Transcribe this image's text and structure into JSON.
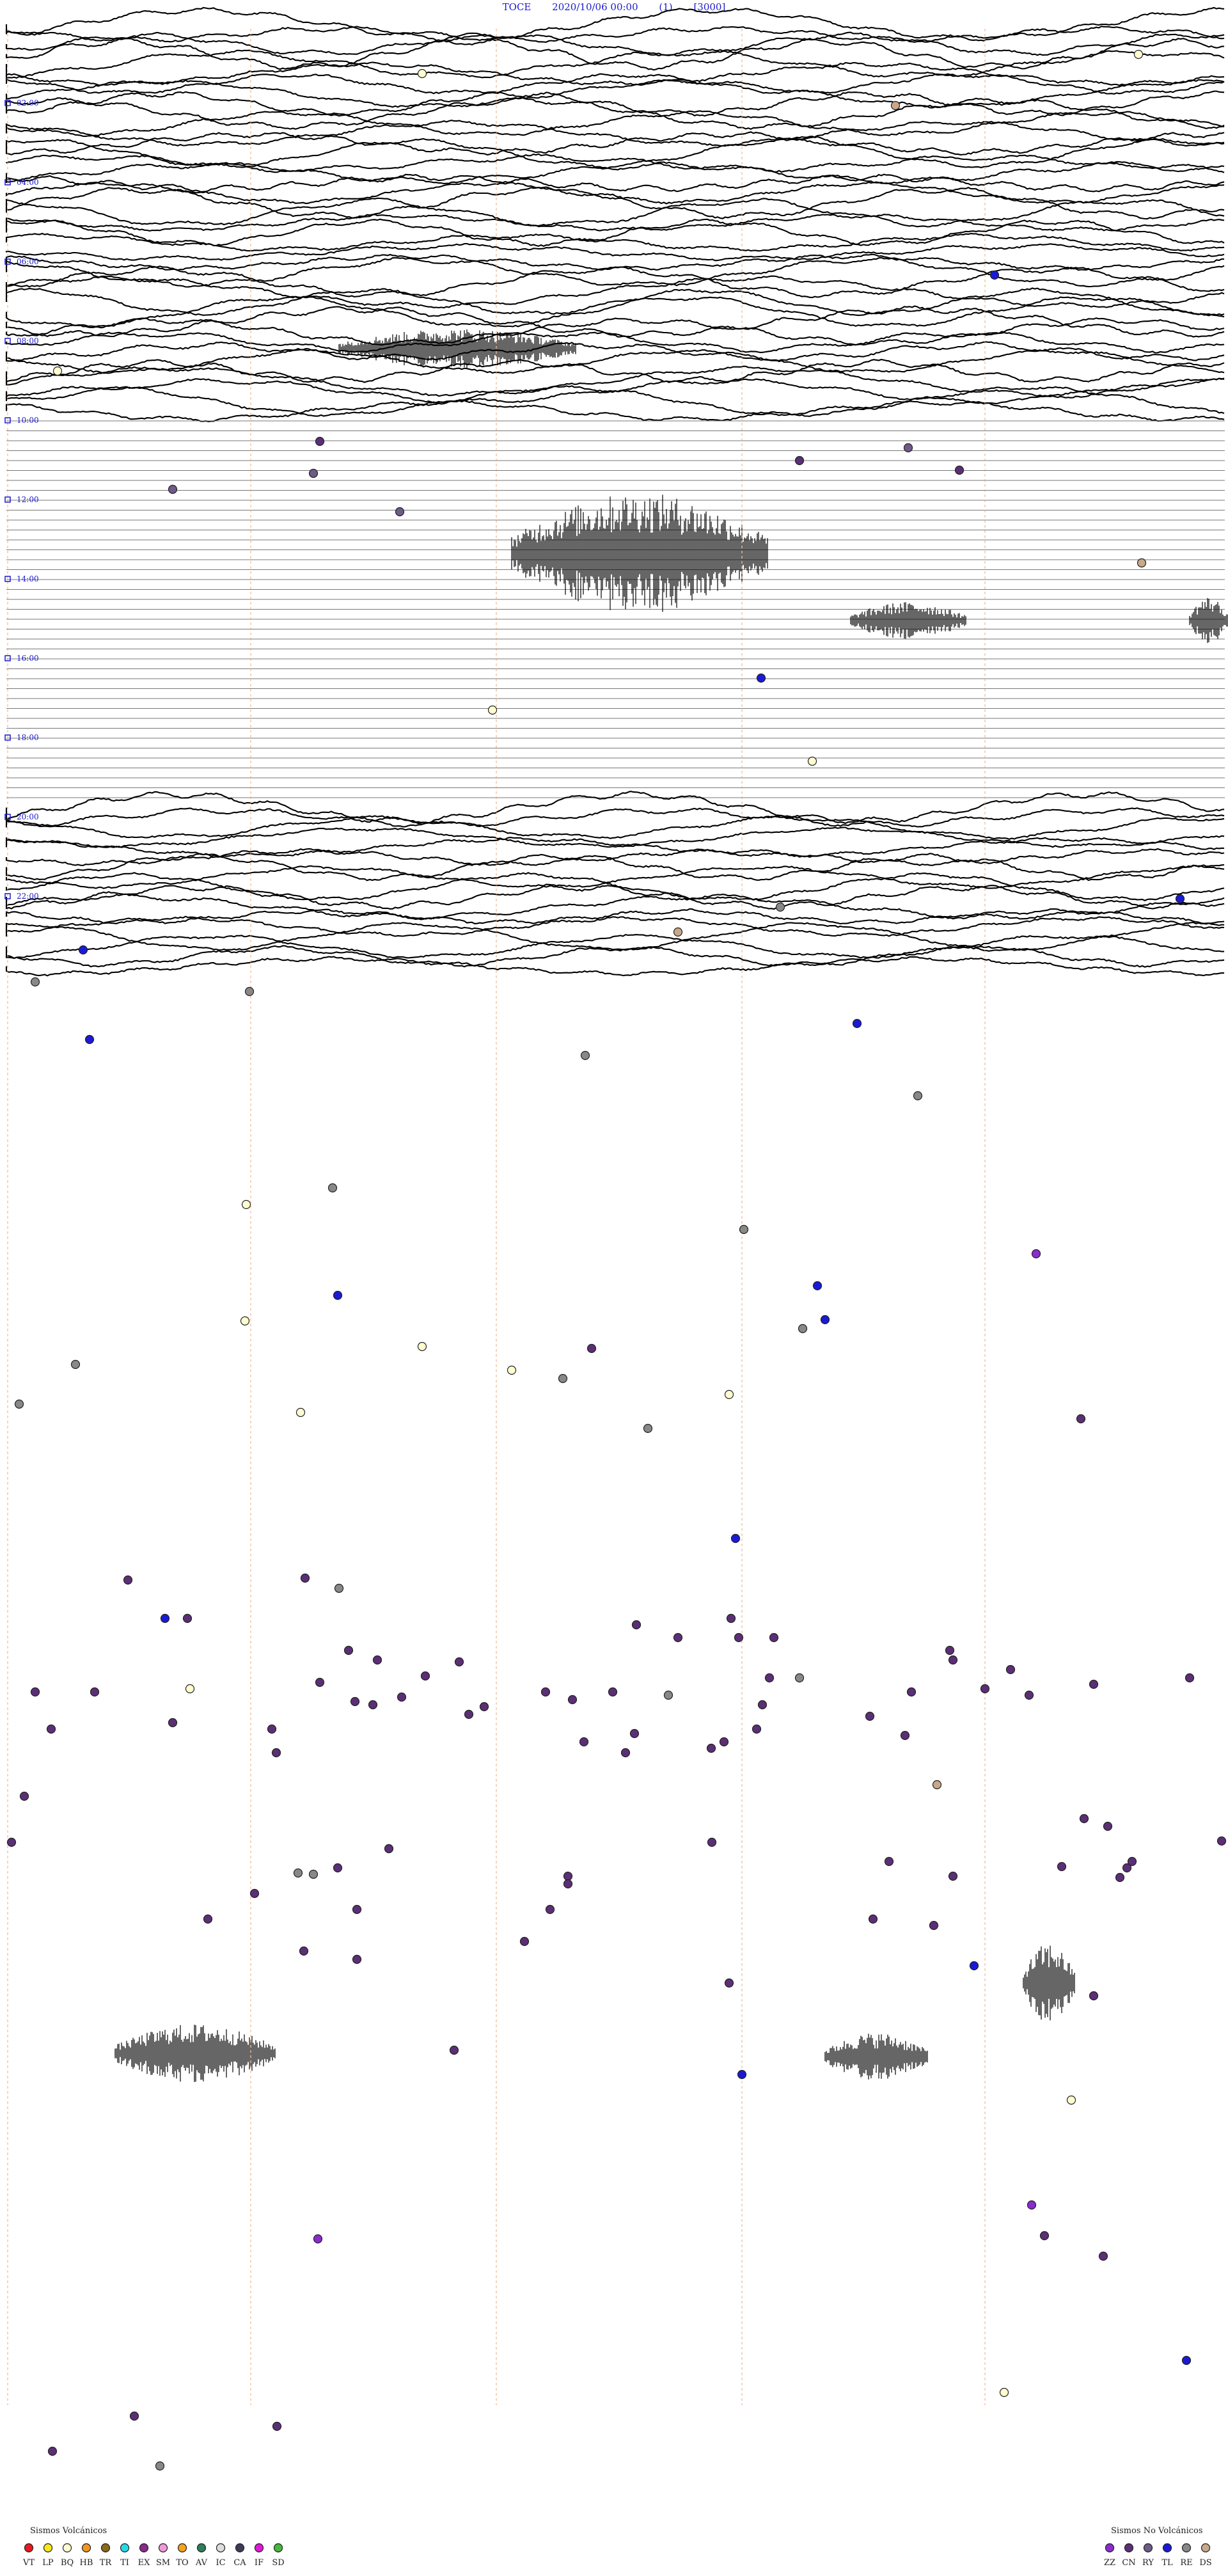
{
  "header": {
    "station": "TOCE",
    "datetime": "2020/10/06 00:00",
    "channel": "(1)",
    "scale": "[3000]"
  },
  "time_labels": [
    "02:00",
    "04:00",
    "06:00",
    "08:00",
    "10:00",
    "12:00",
    "14:00",
    "16:00",
    "18:00",
    "20:00",
    "22:00"
  ],
  "legend_volcanic": {
    "title": "Sismos Volcánicos",
    "items": [
      {
        "code": "VT",
        "color": "#e8191e"
      },
      {
        "code": "LP",
        "color": "#f6e81a"
      },
      {
        "code": "BQ",
        "color": "#fffdd0"
      },
      {
        "code": "HB",
        "color": "#f29425"
      },
      {
        "code": "TR",
        "color": "#8b6a1c"
      },
      {
        "code": "TI",
        "color": "#27d7e8"
      },
      {
        "code": "EX",
        "color": "#8a2b8a"
      },
      {
        "code": "SM",
        "color": "#f09ad9"
      },
      {
        "code": "TO",
        "color": "#f4a11d"
      },
      {
        "code": "AV",
        "color": "#2e7d5b"
      },
      {
        "code": "IC",
        "color": "#dddddd"
      },
      {
        "code": "CA",
        "color": "#3b3b5a"
      },
      {
        "code": "IF",
        "color": "#e019d6"
      },
      {
        "code": "SD",
        "color": "#46b83c"
      }
    ]
  },
  "legend_nonvolcanic": {
    "title": "Sismos No Volcánicos",
    "items": [
      {
        "code": "ZZ",
        "color": "#8b2bd0"
      },
      {
        "code": "CN",
        "color": "#5b2f76"
      },
      {
        "code": "RY",
        "color": "#6e5b88"
      },
      {
        "code": "TL",
        "color": "#1a1ad6"
      },
      {
        "code": "RE",
        "color": "#888888"
      },
      {
        "code": "DS",
        "color": "#c7a889"
      }
    ]
  },
  "colors": {
    "trace": "#000000",
    "gap_line": "#777777",
    "minute_marker": "#f0a070",
    "time_label": "#1a1acc"
  }
}
